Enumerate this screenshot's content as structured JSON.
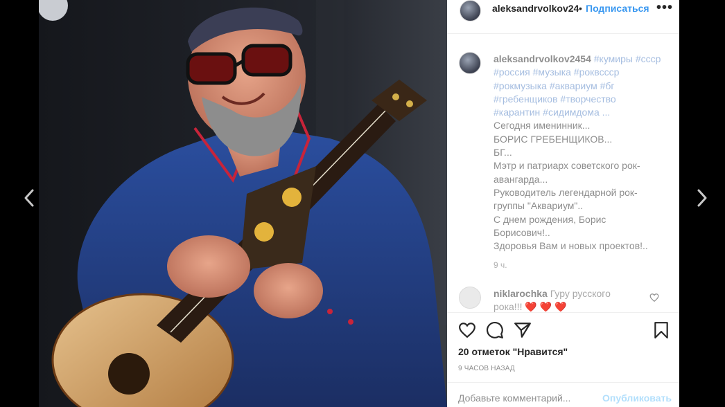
{
  "post": {
    "author": "aleksandrvolkov24",
    "follow_label": "Подписаться",
    "dot": "•",
    "more_label": "•••"
  },
  "caption": {
    "user": "aleksandrvolkov2454",
    "tags_line1": "#кумиры #ссср",
    "tags_line2": "#россия #музыка #роквссср",
    "tags_line3": "#рокмузыка #аквариум #бг",
    "tags_line4": "#гребенщиков #творчество",
    "tags_line5": "#карантин #сидимдома ...",
    "lines": [
      "Сегодня именинник...",
      "БОРИС ГРЕБЕНЩИКОВ...",
      "БГ...",
      "Мэтр и патриарх советского рок-",
      "авангарда...",
      "Руководитель легендарной рок-",
      "группы \"Аквариум\"..",
      "С днем рождения, Борис",
      "Борисович!..",
      "Здоровья Вам и новых проектов!.."
    ],
    "time": "9 ч."
  },
  "comment": {
    "user": "niklarochka",
    "text_line1": "Гуру русского",
    "text_line2": "рока!!! ❤️ ❤️ ❤️"
  },
  "likes": {
    "count_text": "20 отметок \"Нравится\""
  },
  "timestamp": "9 часов назад",
  "add_comment": {
    "placeholder": "Добавьте комментарий...",
    "post_label": "Опубликовать"
  },
  "icons": {
    "prev": "chevron-left-icon",
    "next": "chevron-right-icon",
    "like": "heart-icon",
    "comment": "comment-bubble-icon",
    "share": "paper-plane-icon",
    "save": "bookmark-icon"
  },
  "colors": {
    "link": "#3897f0",
    "hashtag": "#a5bde0",
    "publish": "#b2dffc"
  }
}
